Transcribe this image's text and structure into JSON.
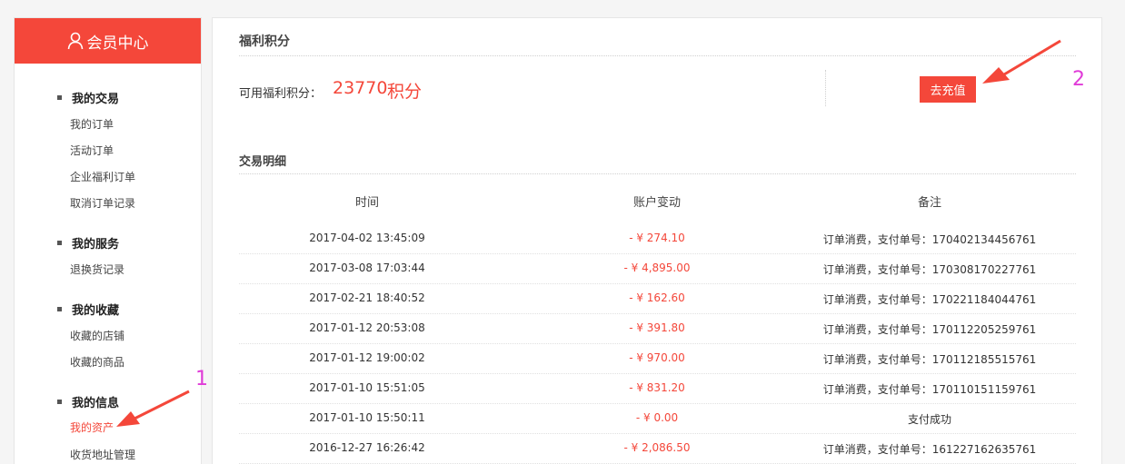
{
  "sidebar": {
    "header": "会员中心",
    "groups": [
      {
        "title": "我的交易",
        "items": [
          "我的订单",
          "活动订单",
          "企业福利订单",
          "取消订单记录"
        ]
      },
      {
        "title": "我的服务",
        "items": [
          "退换货记录"
        ]
      },
      {
        "title": "我的收藏",
        "items": [
          "收藏的店铺",
          "收藏的商品"
        ]
      },
      {
        "title": "我的信息",
        "items": [
          "我的资产",
          "收货地址管理"
        ]
      }
    ]
  },
  "main": {
    "title": "福利积分",
    "points_label": "可用福利积分：",
    "points_value": "23770",
    "points_unit": "积分",
    "recharge_label": "去充值",
    "transactions_title": "交易明细",
    "columns": [
      "时间",
      "账户变动",
      "备注"
    ],
    "rows": [
      {
        "time": "2017-04-02 13:45:09",
        "amount": "- ¥ 274.10",
        "note": "订单消费，支付单号：170402134456761"
      },
      {
        "time": "2017-03-08 17:03:44",
        "amount": "- ¥ 4,895.00",
        "note": "订单消费，支付单号：170308170227761"
      },
      {
        "time": "2017-02-21 18:40:52",
        "amount": "- ¥ 162.60",
        "note": "订单消费，支付单号：170221184044761"
      },
      {
        "time": "2017-01-12 20:53:08",
        "amount": "- ¥ 391.80",
        "note": "订单消费，支付单号：170112205259761"
      },
      {
        "time": "2017-01-12 19:00:02",
        "amount": "- ¥ 970.00",
        "note": "订单消费，支付单号：170112185515761"
      },
      {
        "time": "2017-01-10 15:51:05",
        "amount": "- ¥ 831.20",
        "note": "订单消费，支付单号：170110151159761"
      },
      {
        "time": "2017-01-10 15:50:11",
        "amount": "- ¥ 0.00",
        "note": "支付成功"
      },
      {
        "time": "2016-12-27 16:26:42",
        "amount": "- ¥ 2,086.50",
        "note": "订单消费，支付单号：161227162635761"
      }
    ]
  },
  "annotations": [
    "1",
    "2"
  ],
  "colors": {
    "accent": "#f4473a",
    "annotation": "#e03bd8"
  }
}
